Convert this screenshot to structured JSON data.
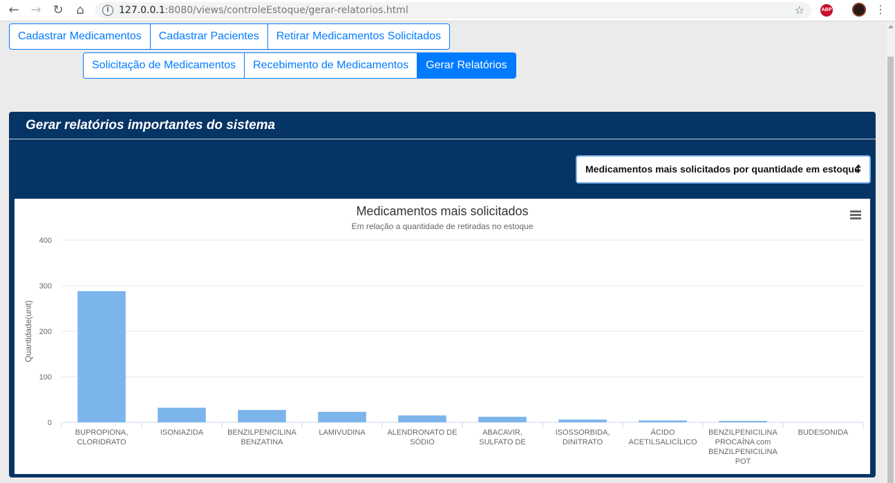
{
  "browser": {
    "url_host": "127.0.0.1",
    "url_rest": ":8080/views/controleEstoque/gerar-relatorios.html",
    "extension_badge": "ABP",
    "icons": [
      "back-icon",
      "forward-icon",
      "reload-icon",
      "home-icon",
      "info-icon",
      "star-icon",
      "menu-icon"
    ]
  },
  "nav": {
    "row1": [
      "Cadastrar Medicamentos",
      "Cadastrar Pacientes",
      "Retirar Medicamentos Solicitados"
    ],
    "row2": [
      "Solicitação de Medicamentos",
      "Recebimento de Medicamentos",
      "Gerar Relatórios"
    ],
    "active": "Gerar Relatórios"
  },
  "panel": {
    "title": "Gerar relatórios importantes do sistema",
    "select_value": "Medicamentos mais solicitados por quantidade em estoque"
  },
  "colors": {
    "accent": "#007bff",
    "panel_bg": "#063464",
    "bar": "#7cb5ec"
  },
  "chart_data": {
    "type": "bar",
    "title": "Medicamentos mais solicitados",
    "subtitle": "Em relação a quantidade de retiradas no estoque",
    "xlabel": "",
    "ylabel": "Quantidade(unit)",
    "ylim": [
      0,
      400
    ],
    "yticks": [
      0,
      100,
      200,
      300,
      400
    ],
    "grid": true,
    "legend": "none",
    "menu_icon": "hamburger-menu-icon",
    "categories": [
      [
        "BUPROPIONA,",
        "CLORIDRATO"
      ],
      [
        "ISONIAZIDA"
      ],
      [
        "BENZILPENICILINA",
        "BENZATINA"
      ],
      [
        "LAMIVUDINA"
      ],
      [
        "ALENDRONATO DE",
        "SÓDIO"
      ],
      [
        "ABACAVIR,",
        "SULFATO DE"
      ],
      [
        "ISOSSORBIDA,",
        "DINITRATO"
      ],
      [
        "ÁCIDO",
        "ACETILSALICÍLICO"
      ],
      [
        "BENZILPENICILINA",
        "PROCAÍNA com",
        "BENZILPENICILINA",
        "POT"
      ],
      [
        "BUDESONIDA"
      ]
    ],
    "values": [
      288,
      32,
      27,
      23,
      15,
      12,
      6,
      4,
      3,
      0
    ]
  }
}
